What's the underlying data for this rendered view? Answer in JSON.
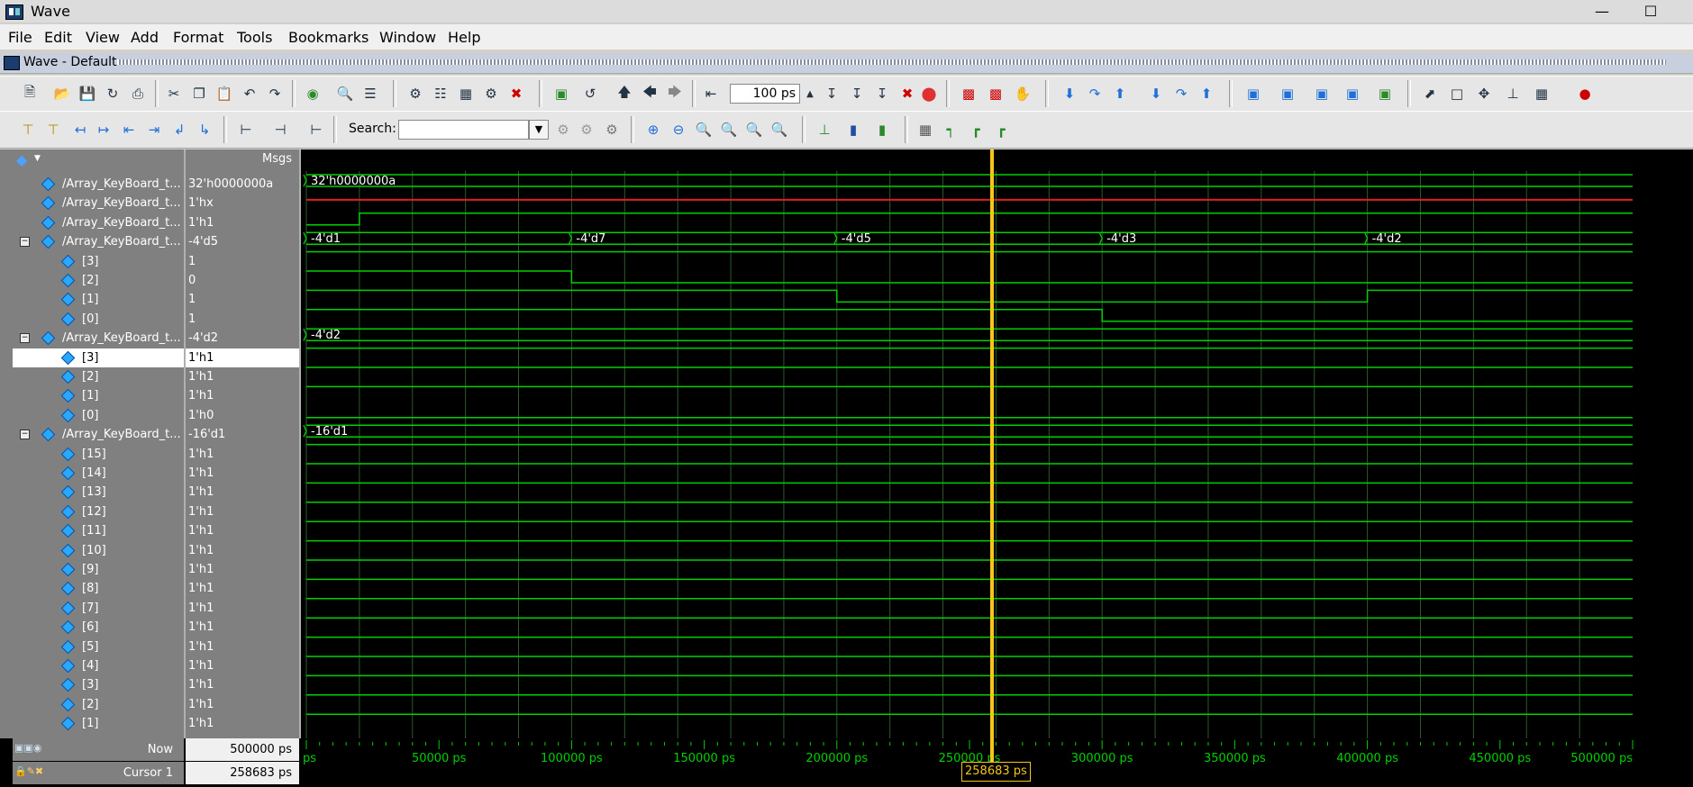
{
  "window": {
    "title": "Wave",
    "subtitle": "Wave - Default"
  },
  "menu": [
    "File",
    "Edit",
    "View",
    "Add",
    "Format",
    "Tools",
    "Bookmarks",
    "Window",
    "Help"
  ],
  "toolbar": {
    "time_value": "100 ps",
    "search_label": "Search:",
    "search_value": ""
  },
  "header": {
    "msgs": "Msgs"
  },
  "signals": [
    {
      "name": "/Array_KeyBoard_t...",
      "value": "32'h0000000a",
      "level": 0,
      "expand": false
    },
    {
      "name": "/Array_KeyBoard_t...",
      "value": "1'hx",
      "level": 0,
      "expand": false
    },
    {
      "name": "/Array_KeyBoard_t...",
      "value": "1'h1",
      "level": 0,
      "expand": false
    },
    {
      "name": "/Array_KeyBoard_t...",
      "value": "-4'd5",
      "level": 0,
      "expand": true
    },
    {
      "name": "[3]",
      "value": "1",
      "level": 1
    },
    {
      "name": "[2]",
      "value": "0",
      "level": 1
    },
    {
      "name": "[1]",
      "value": "1",
      "level": 1
    },
    {
      "name": "[0]",
      "value": "1",
      "level": 1
    },
    {
      "name": "/Array_KeyBoard_t...",
      "value": "-4'd2",
      "level": 0,
      "expand": true
    },
    {
      "name": "[3]",
      "value": "1'h1",
      "level": 1,
      "selected": true
    },
    {
      "name": "[2]",
      "value": "1'h1",
      "level": 1
    },
    {
      "name": "[1]",
      "value": "1'h1",
      "level": 1
    },
    {
      "name": "[0]",
      "value": "1'h0",
      "level": 1
    },
    {
      "name": "/Array_KeyBoard_t...",
      "value": "-16'd1",
      "level": 0,
      "expand": true
    },
    {
      "name": "[15]",
      "value": "1'h1",
      "level": 1
    },
    {
      "name": "[14]",
      "value": "1'h1",
      "level": 1
    },
    {
      "name": "[13]",
      "value": "1'h1",
      "level": 1
    },
    {
      "name": "[12]",
      "value": "1'h1",
      "level": 1
    },
    {
      "name": "[11]",
      "value": "1'h1",
      "level": 1
    },
    {
      "name": "[10]",
      "value": "1'h1",
      "level": 1
    },
    {
      "name": "[9]",
      "value": "1'h1",
      "level": 1
    },
    {
      "name": "[8]",
      "value": "1'h1",
      "level": 1
    },
    {
      "name": "[7]",
      "value": "1'h1",
      "level": 1
    },
    {
      "name": "[6]",
      "value": "1'h1",
      "level": 1
    },
    {
      "name": "[5]",
      "value": "1'h1",
      "level": 1
    },
    {
      "name": "[4]",
      "value": "1'h1",
      "level": 1
    },
    {
      "name": "[3]",
      "value": "1'h1",
      "level": 1
    },
    {
      "name": "[2]",
      "value": "1'h1",
      "level": 1
    },
    {
      "name": "[1]",
      "value": "1'h1",
      "level": 1
    }
  ],
  "bus_labels": {
    "bus0": [
      "32'h0000000a"
    ],
    "bus3": [
      "-4'd1",
      "-4'd7",
      "-4'd5",
      "-4'd3",
      "-4'd2"
    ],
    "bus8": [
      "-4'd2"
    ],
    "bus13": [
      "-16'd1"
    ]
  },
  "status": {
    "now_label": "Now",
    "now_value": "500000 ps",
    "cursor_label": "Cursor 1",
    "cursor_value": "258683 ps",
    "cursor_tag": "258683 ps"
  },
  "timeline": {
    "ticks": [
      "ps",
      "50000 ps",
      "100000 ps",
      "150000 ps",
      "200000 ps",
      "250000 ps",
      "300000 ps",
      "350000 ps",
      "400000 ps",
      "450000 ps",
      "500000 ps"
    ]
  },
  "colors": {
    "wave": "#00d000",
    "x_state": "#e02020",
    "cursor": "#f5c518",
    "grid": "#2c5a2c"
  }
}
